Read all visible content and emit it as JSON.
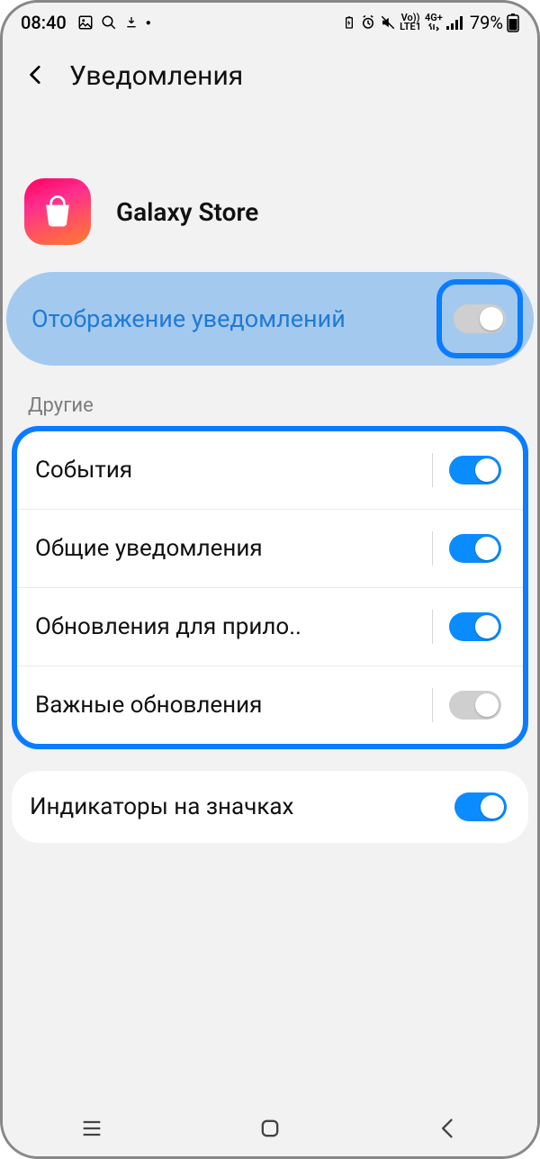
{
  "status": {
    "time": "08:40",
    "volte_top": "Vo))",
    "volte_bottom": "LTE1",
    "net_top": "4G+",
    "battery_pct": "79%"
  },
  "header": {
    "title": "Уведомления"
  },
  "app": {
    "name": "Galaxy Store"
  },
  "master": {
    "label": "Отображение уведомлений",
    "on": false
  },
  "section_other": "Другие",
  "categories": [
    {
      "label": "События",
      "on": true
    },
    {
      "label": "Общие уведомления",
      "on": true
    },
    {
      "label": "Обновления для прило..",
      "on": true
    },
    {
      "label": "Важные обновления",
      "on": false
    }
  ],
  "badges": {
    "label": "Индикаторы на значках",
    "on": true
  }
}
